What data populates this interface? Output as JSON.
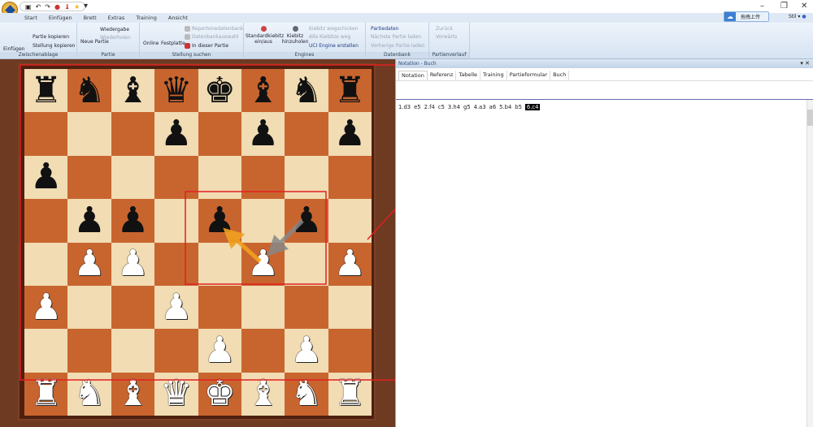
{
  "qat": [
    "save",
    "undo",
    "redo",
    "engine",
    "figure",
    "star"
  ],
  "tabs": [
    "Start",
    "Einfügen",
    "Brett",
    "Extras",
    "Training",
    "Ansicht"
  ],
  "ribbon": {
    "clipboard": {
      "label": "Zwischenablage",
      "items": [
        "Partie kopieren",
        "Stellung kopieren",
        "Einfügen"
      ]
    },
    "game": {
      "label": "Partie",
      "items": [
        "Neue Partie",
        "Wiedergabe",
        "Wiederholen"
      ]
    },
    "search": {
      "label": "Stellung suchen",
      "online": "Online",
      "disk": "Festplatte",
      "items": [
        "Repertoiredatenbank",
        "Datenbankauswahl",
        "In dieser Partie"
      ]
    },
    "engines": {
      "label": "Engines",
      "std": "Standardkiebitz ein/aus",
      "add": "Kiebitz hinzuholen",
      "items": [
        "Kiebitz wegschicken",
        "Alle Kiebitze weg",
        "UCI Engine erstellen"
      ]
    },
    "db": {
      "label": "Datenbank",
      "items": [
        "Partiedaten",
        "Nächste Partie laden",
        "Vorherige Partie laden"
      ]
    },
    "hist": {
      "label": "Partienverlauf",
      "items": [
        "Zurück",
        "Vorwärts"
      ]
    }
  },
  "upload_label": "拖拽上传",
  "style_label": "Stil",
  "panel": {
    "title": "Notation - Buch",
    "tabs": [
      "Notation",
      "Referenz",
      "Tabelle",
      "Training",
      "Partieformular",
      "Buch"
    ]
  },
  "moves": [
    "1.d3",
    "e5",
    "2.f4",
    "c5",
    "3.h4",
    "g5",
    "4.a3",
    "a6",
    "5.b4",
    "b5"
  ],
  "current_move": "6.c4",
  "board": [
    "rnbqkbnr",
    "...p.p.p",
    "p.......",
    ".pp.p.p.",
    ".PP..P.P",
    "P..P....",
    "....P.P.",
    "RNBQKBNR"
  ],
  "colors": {
    "annotation": "#e02020",
    "arrow_orange": "#f0a020",
    "arrow_gray": "#888888"
  }
}
